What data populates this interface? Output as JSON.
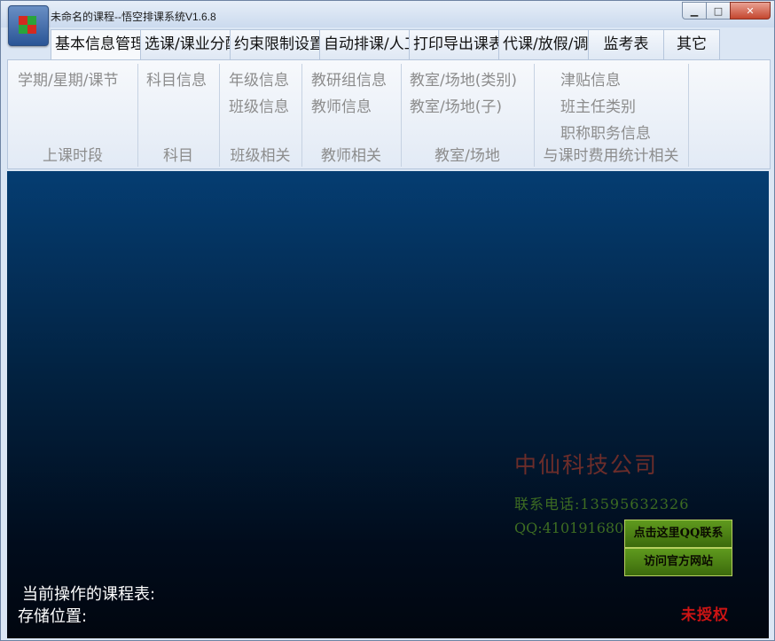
{
  "window": {
    "title": "未命名的课程--悟空排课系统V1.6.8",
    "controls": {
      "minimize": "▁",
      "maximize": "□",
      "close": "✕"
    }
  },
  "tabs": [
    {
      "label": "基本信息管理"
    },
    {
      "label": "选课/课业分配"
    },
    {
      "label": "约束限制设置"
    },
    {
      "label": "自动排课/人工"
    },
    {
      "label": "打印导出课表"
    },
    {
      "label": "代课/放假/调课"
    },
    {
      "label": "监考表"
    },
    {
      "label": "其它"
    }
  ],
  "ribbon": {
    "groups": [
      {
        "name": "上课时段",
        "items": [
          "学期/星期/课节"
        ]
      },
      {
        "name": "科目",
        "items": [
          "科目信息"
        ]
      },
      {
        "name": "班级相关",
        "items": [
          "年级信息",
          "班级信息"
        ]
      },
      {
        "name": "教师相关",
        "items": [
          "教研组信息",
          "教师信息"
        ]
      },
      {
        "name": "教室/场地",
        "items": [
          "教室/场地(类别)",
          "教室/场地(子)"
        ]
      },
      {
        "name": "与课时费用统计相关",
        "items": [
          "津贴信息",
          "班主任类别",
          "职称职务信息"
        ]
      }
    ]
  },
  "main": {
    "company": "中仙科技公司",
    "phone": "联系电话:13595632326",
    "qq": "QQ:410191680",
    "qq_button": "点击这里QQ联系",
    "website_button": "访问官方网站",
    "current_schedule_label": "当前操作的课程表:",
    "storage_label": "存储位置:",
    "license_status": "未授权"
  },
  "colors": {
    "company": "#6c2d2a",
    "contact": "#3d6c22",
    "button_bg": "#4f8417",
    "unauthorized": "#cc1414"
  }
}
